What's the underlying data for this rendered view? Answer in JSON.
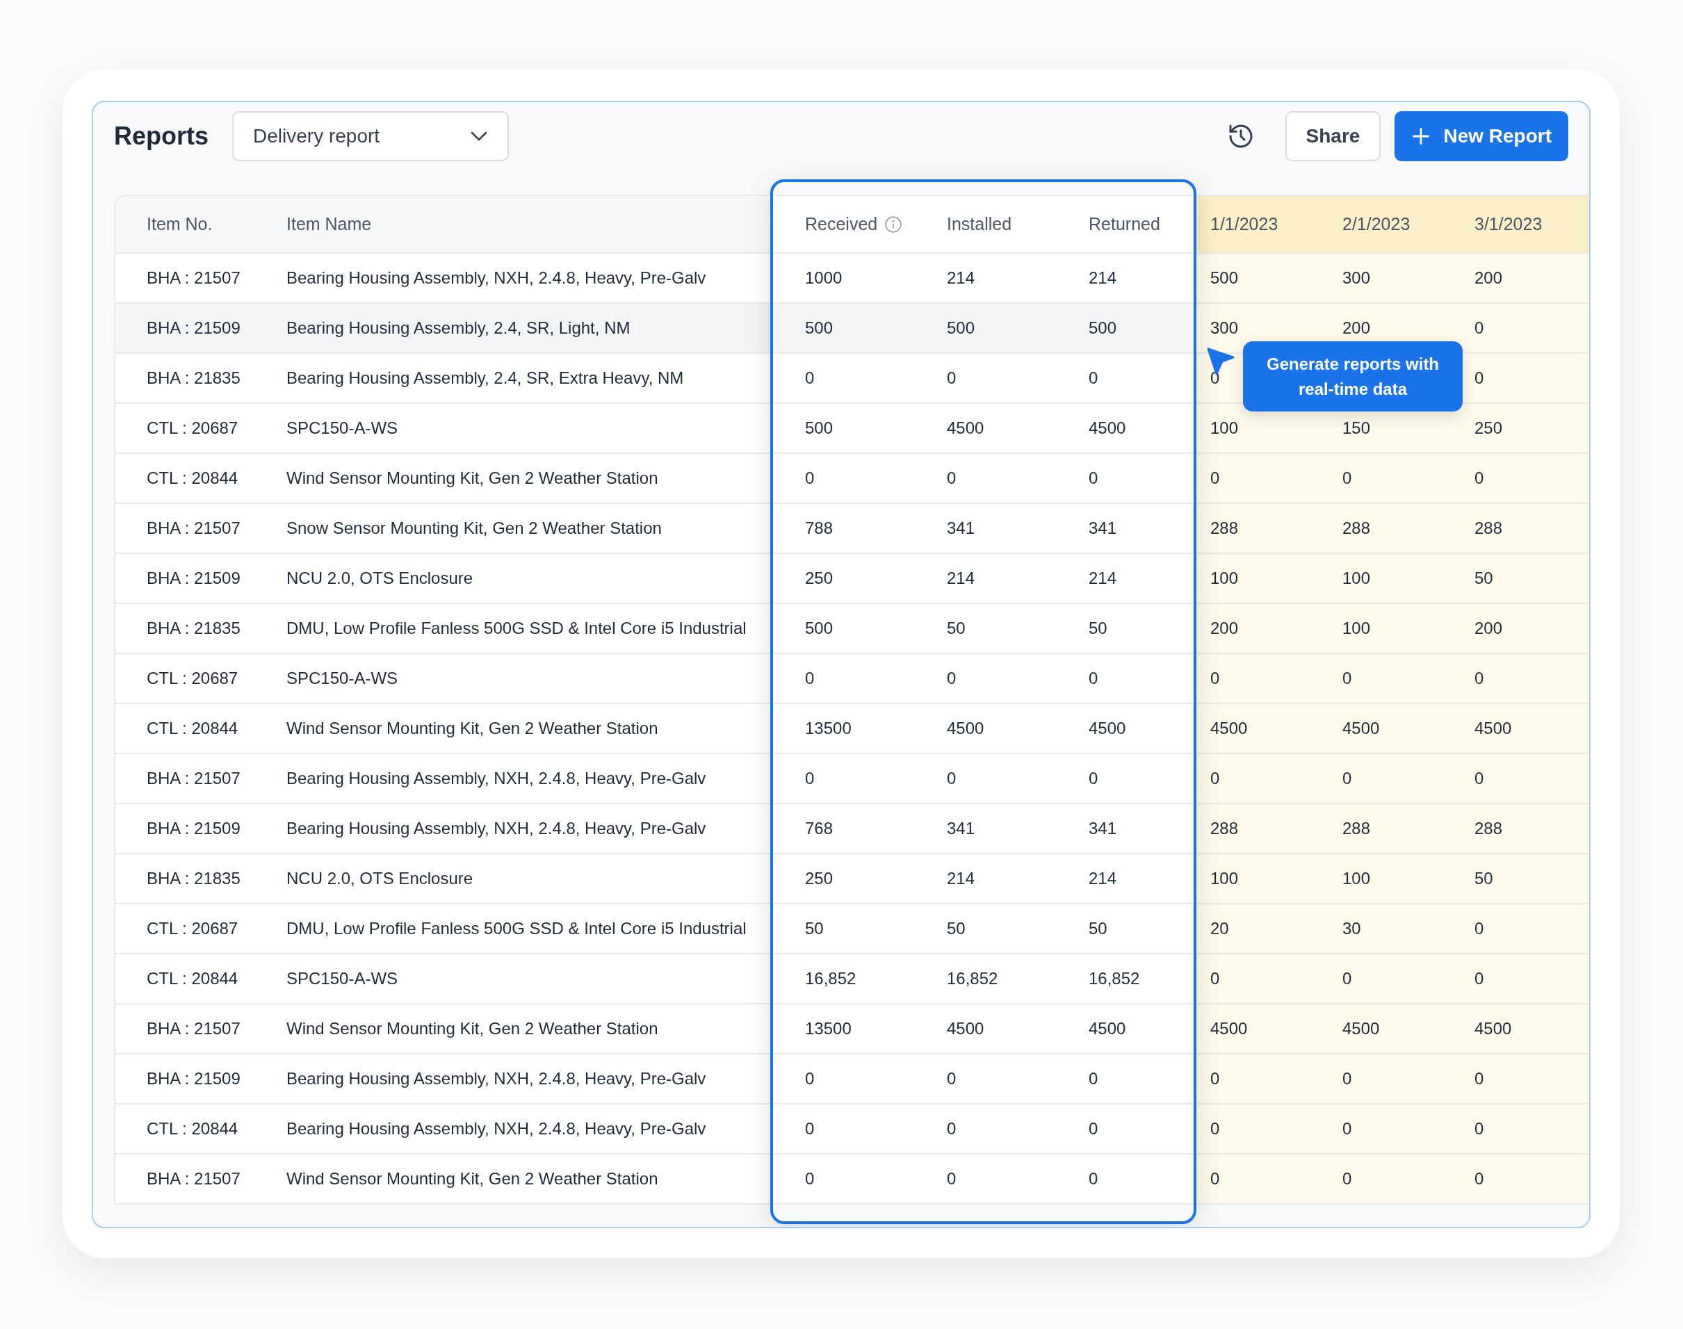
{
  "header": {
    "title": "Reports",
    "report_select": {
      "value": "Delivery report"
    },
    "buttons": [
      {
        "kind": "history"
      },
      {
        "kind": "outline",
        "label": "Share"
      },
      {
        "kind": "primary",
        "label": "New Report"
      }
    ]
  },
  "table": {
    "columns": [
      {
        "label": "Item No.",
        "kind": "item",
        "info": false
      },
      {
        "label": "Item Name",
        "kind": "item",
        "info": false
      },
      {
        "label": "Received",
        "kind": "metric",
        "info": true
      },
      {
        "label": "Installed",
        "kind": "metric",
        "info": false
      },
      {
        "label": "Returned",
        "kind": "metric",
        "info": false
      },
      {
        "label": "1/1/2023",
        "kind": "date",
        "info": false
      },
      {
        "label": "2/1/2023",
        "kind": "date",
        "info": false
      },
      {
        "label": "3/1/2023",
        "kind": "date",
        "info": false
      }
    ],
    "rows": [
      {
        "highlighted": false,
        "cells": [
          "BHA : 21507",
          "Bearing Housing Assembly, NXH, 2.4.8, Heavy, Pre-Galv",
          "1000",
          "214",
          "214",
          "500",
          "300",
          "200"
        ]
      },
      {
        "highlighted": true,
        "cells": [
          "BHA : 21509",
          "Bearing Housing Assembly, 2.4, SR, Light, NM",
          "500",
          "500",
          "500",
          "300",
          "200",
          "0"
        ]
      },
      {
        "highlighted": false,
        "cells": [
          "BHA : 21835",
          "Bearing Housing Assembly, 2.4, SR, Extra Heavy, NM",
          "0",
          "0",
          "0",
          "0",
          null,
          "0"
        ]
      },
      {
        "highlighted": false,
        "cells": [
          "CTL : 20687",
          "SPC150-A-WS",
          "500",
          "4500",
          "4500",
          "100",
          "150",
          "250"
        ]
      },
      {
        "highlighted": false,
        "cells": [
          "CTL : 20844",
          "Wind Sensor Mounting Kit, Gen 2 Weather Station",
          "0",
          "0",
          "0",
          "0",
          "0",
          "0"
        ]
      },
      {
        "highlighted": false,
        "cells": [
          "BHA : 21507",
          "Snow Sensor Mounting Kit, Gen 2 Weather Station",
          "788",
          "341",
          "341",
          "288",
          "288",
          "288"
        ]
      },
      {
        "highlighted": false,
        "cells": [
          "BHA : 21509",
          "NCU 2.0, OTS Enclosure",
          "250",
          "214",
          "214",
          "100",
          "100",
          "50"
        ]
      },
      {
        "highlighted": false,
        "cells": [
          "BHA : 21835",
          "DMU, Low Profile Fanless 500G SSD & Intel Core i5 Industrial",
          "500",
          "50",
          "50",
          "200",
          "100",
          "200"
        ]
      },
      {
        "highlighted": false,
        "cells": [
          "CTL : 20687",
          "SPC150-A-WS",
          "0",
          "0",
          "0",
          "0",
          "0",
          "0"
        ]
      },
      {
        "highlighted": false,
        "cells": [
          "CTL : 20844",
          "Wind Sensor Mounting Kit, Gen 2 Weather Station",
          "13500",
          "4500",
          "4500",
          "4500",
          "4500",
          "4500"
        ]
      },
      {
        "highlighted": false,
        "cells": [
          "BHA : 21507",
          "Bearing Housing Assembly, NXH, 2.4.8, Heavy, Pre-Galv",
          "0",
          "0",
          "0",
          "0",
          "0",
          "0"
        ]
      },
      {
        "highlighted": false,
        "cells": [
          "BHA : 21509",
          "Bearing Housing Assembly, NXH, 2.4.8, Heavy, Pre-Galv",
          "768",
          "341",
          "341",
          "288",
          "288",
          "288"
        ]
      },
      {
        "highlighted": false,
        "cells": [
          "BHA : 21835",
          "NCU 2.0, OTS Enclosure",
          "250",
          "214",
          "214",
          "100",
          "100",
          "50"
        ]
      },
      {
        "highlighted": false,
        "cells": [
          "CTL : 20687",
          "DMU, Low Profile Fanless 500G SSD & Intel Core i5 Industrial",
          "50",
          "50",
          "50",
          "20",
          "30",
          "0"
        ]
      },
      {
        "highlighted": false,
        "cells": [
          "CTL : 20844",
          "SPC150-A-WS",
          "16,852",
          "16,852",
          "16,852",
          "0",
          "0",
          "0"
        ]
      },
      {
        "highlighted": false,
        "cells": [
          "BHA : 21507",
          "Wind Sensor Mounting Kit, Gen 2 Weather Station",
          "13500",
          "4500",
          "4500",
          "4500",
          "4500",
          "4500"
        ]
      },
      {
        "highlighted": false,
        "cells": [
          "BHA : 21509",
          "Bearing Housing Assembly, NXH, 2.4.8, Heavy, Pre-Galv",
          "0",
          "0",
          "0",
          "0",
          "0",
          "0"
        ]
      },
      {
        "highlighted": false,
        "cells": [
          "CTL : 20844",
          "Bearing Housing Assembly, NXH, 2.4.8, Heavy, Pre-Galv",
          "0",
          "0",
          "0",
          "0",
          "0",
          "0"
        ]
      },
      {
        "highlighted": false,
        "cells": [
          "BHA : 21507",
          "Wind Sensor Mounting Kit, Gen 2 Weather Station",
          "0",
          "0",
          "0",
          "0",
          "0",
          "0"
        ]
      }
    ]
  },
  "tooltip": {
    "text": "Generate reports with real-time data"
  }
}
